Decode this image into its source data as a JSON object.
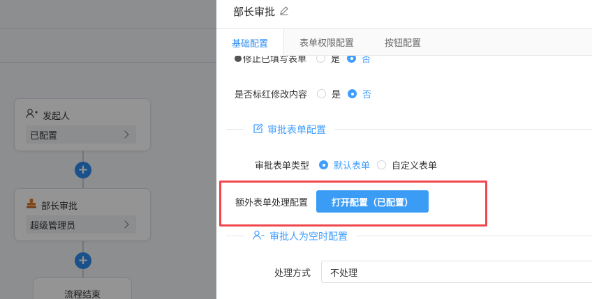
{
  "flow": {
    "nodes": [
      {
        "title": "发起人",
        "value": "已配置",
        "icon": "add-user-icon"
      },
      {
        "title": "部长审批",
        "value": "超级管理员",
        "icon": "stamp-icon"
      }
    ],
    "add_label": "+",
    "end_label": "流程结束"
  },
  "drawer": {
    "title": "部长审批",
    "edit_icon": "pencil-icon",
    "tabs": [
      {
        "label": "基础配置",
        "active": true
      },
      {
        "label": "表单权限配置",
        "active": false
      },
      {
        "label": "按钮配置",
        "active": false
      }
    ],
    "rows": {
      "prevent_edit": {
        "label": "修止已填写表单",
        "options": [
          "是",
          "否"
        ],
        "selected": "否"
      },
      "mark_red": {
        "label": "是否标红修改内容",
        "options": [
          "是",
          "否"
        ],
        "selected": "否"
      }
    },
    "section_form": {
      "title": "审批表单配置",
      "icon": "edit-form-icon"
    },
    "form_type": {
      "label": "审批表单类型",
      "options": [
        "默认表单",
        "自定义表单"
      ],
      "selected": "默认表单"
    },
    "extra_form": {
      "label": "额外表单处理配置",
      "button_label": "打开配置（已配置）"
    },
    "section_empty": {
      "title": "审批人为空时配置",
      "icon": "user-minus-icon"
    },
    "handling": {
      "label": "处理方式",
      "value": "不处理"
    }
  },
  "colors": {
    "accent": "#409eff",
    "primary_button": "#3b9cf5",
    "add_button": "#2d8cf0",
    "highlight_border": "#f0474d"
  }
}
